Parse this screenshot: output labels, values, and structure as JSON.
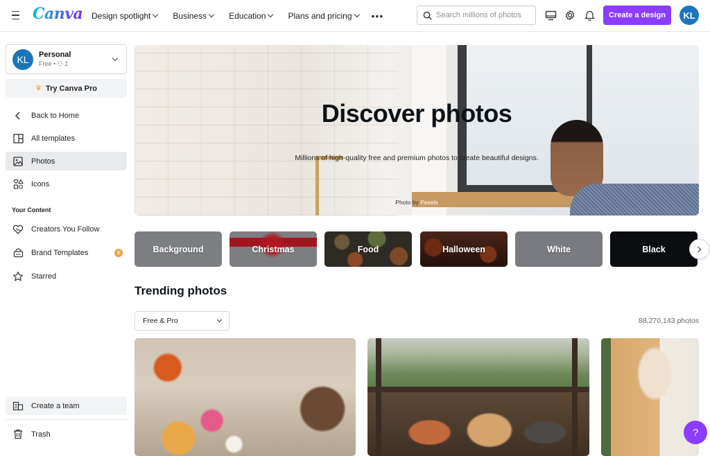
{
  "topbar": {
    "logo": "Canva",
    "nav": [
      {
        "label": "Design spotlight"
      },
      {
        "label": "Business"
      },
      {
        "label": "Education"
      },
      {
        "label": "Plans and pricing"
      }
    ],
    "search_placeholder": "Search millions of photos",
    "create_label": "Create a design",
    "avatar_initials": "KL",
    "brand_color": "#8b3dff"
  },
  "sidebar": {
    "account": {
      "initials": "KL",
      "name": "Personal",
      "plan": "Free",
      "members": "1"
    },
    "try_pro": "Try Canva Pro",
    "items": [
      {
        "label": "Back to Home",
        "icon": "chevron-left-icon"
      },
      {
        "label": "All templates",
        "icon": "templates-icon"
      },
      {
        "label": "Photos",
        "icon": "photo-icon",
        "active": true
      },
      {
        "label": "Icons",
        "icon": "shapes-icon"
      }
    ],
    "section_label": "Your Content",
    "content_items": [
      {
        "label": "Creators You Follow",
        "icon": "heart-icon"
      },
      {
        "label": "Brand Templates",
        "icon": "brand-kit-icon",
        "pro": true
      },
      {
        "label": "Starred",
        "icon": "star-icon"
      }
    ],
    "bottom_items": [
      {
        "label": "Create a team",
        "icon": "team-icon"
      },
      {
        "label": "Trash",
        "icon": "trash-icon"
      }
    ]
  },
  "hero": {
    "title": "Discover photos",
    "subtitle": "Millions of high-quality free and premium photos to create beautiful designs.",
    "credit_prefix": "Photo by ",
    "credit_link": "Pexels"
  },
  "categories": [
    {
      "label": "Background",
      "bg": "#7c7e82"
    },
    {
      "label": "Christmas",
      "bg": "#7d7e82"
    },
    {
      "label": "Food",
      "bg": "#3a342c"
    },
    {
      "label": "Halloween",
      "bg": "#3a1d14"
    },
    {
      "label": "White",
      "bg": "#7a7b80"
    },
    {
      "label": "Black",
      "bg": "#0b0d10"
    }
  ],
  "trending": {
    "title": "Trending photos",
    "filter_value": "Free & Pro",
    "count": "88,270,143 photos"
  },
  "help_label": "?"
}
